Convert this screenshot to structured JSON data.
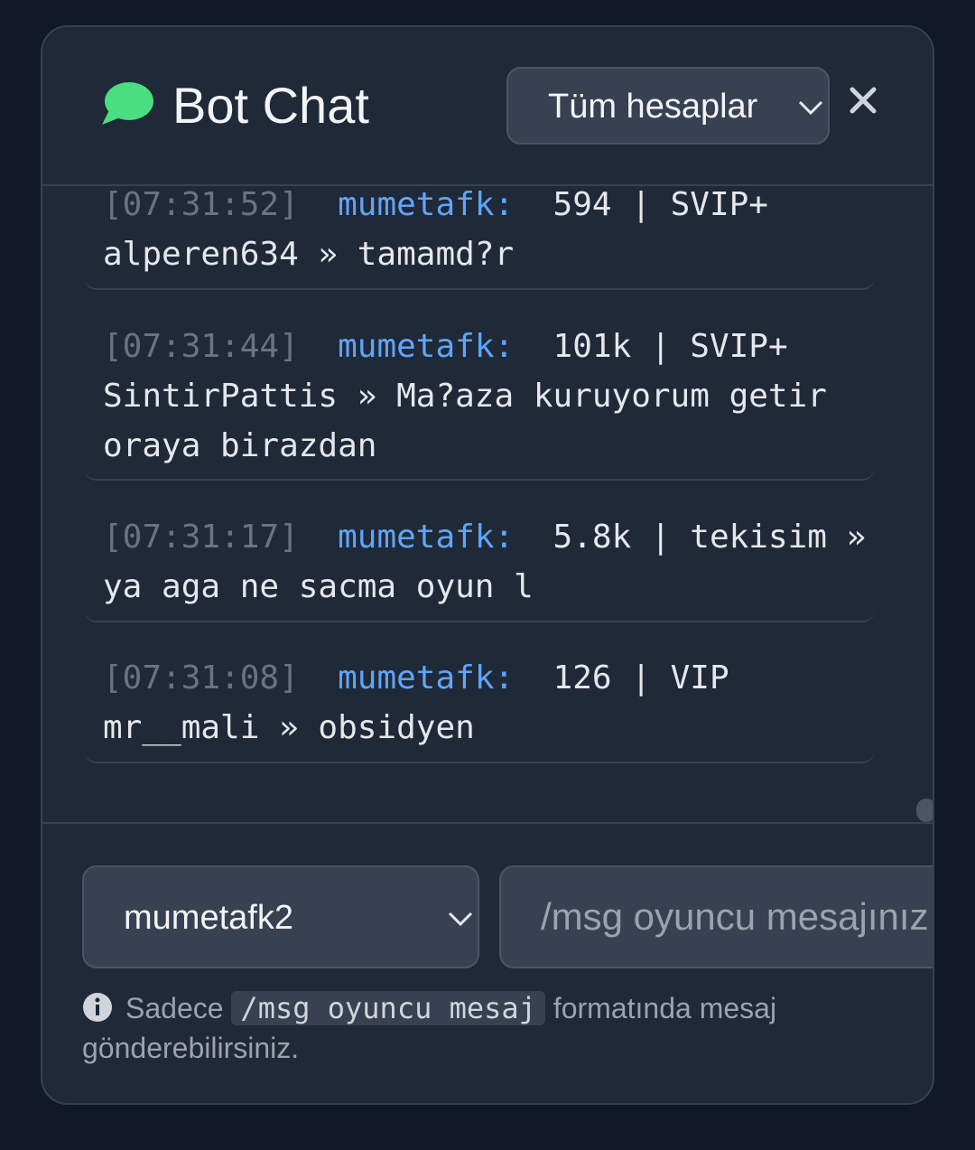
{
  "header": {
    "title": "Bot Chat",
    "account_filter": "Tüm hesaplar"
  },
  "messages": [
    {
      "time": "[07:31:52]",
      "user": "mumetafk:",
      "text": "594 | SVIP+ alperen634 » tamamd?r"
    },
    {
      "time": "[07:31:44]",
      "user": "mumetafk:",
      "text": "101k | SVIP+ SintirPattis » Ma?aza kuruyorum getir oraya birazdan"
    },
    {
      "time": "[07:31:17]",
      "user": "mumetafk:",
      "text": "5.8k | tekisim » ya aga ne sacma oyun l"
    },
    {
      "time": "[07:31:08]",
      "user": "mumetafk:",
      "text": "126 | VIP mr__mali » obsidyen"
    }
  ],
  "composer": {
    "sender": "mumetafk2",
    "placeholder": "/msg oyuncu mesajınız",
    "hint_prefix": "Sadece",
    "hint_code": "/msg oyuncu mesaj",
    "hint_suffix": "formatında mesaj gönderebilirsiniz."
  },
  "colors": {
    "background": "#111827",
    "panel": "#1f2937",
    "accent_green": "#4ade80",
    "username_blue": "#60a5fa",
    "timestamp_gray": "#6b7280"
  },
  "icons": [
    "chat-bubble-icon",
    "chevron-down-icon",
    "close-icon",
    "info-icon"
  ]
}
